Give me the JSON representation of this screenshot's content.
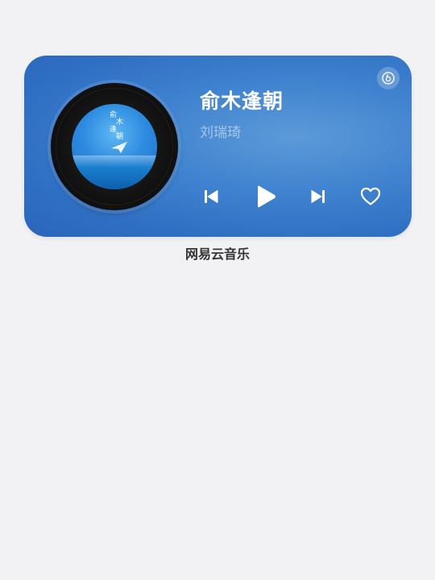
{
  "widget": {
    "song_title": "俞木逢朝",
    "artist": "刘瑞琦",
    "cover": {
      "title_chars": [
        "俞",
        "木",
        "逢",
        "朝"
      ]
    },
    "controls": {
      "previous_icon": "skip-previous-icon",
      "play_icon": "play-icon",
      "next_icon": "skip-next-icon",
      "like_icon": "heart-icon"
    },
    "brand_icon": "netease-cloud-music-icon",
    "colors": {
      "card_background": "#3f82cf",
      "title_text": "#ffffff",
      "artist_text": "#9fc0e6"
    }
  },
  "app_label": "网易云音乐"
}
